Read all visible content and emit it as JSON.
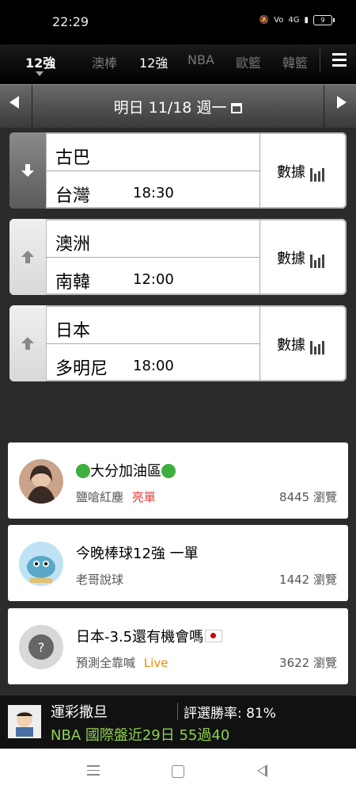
{
  "status": {
    "time": "22:29",
    "network": "4G",
    "battery": "9"
  },
  "tabs": [
    {
      "label": "12強"
    },
    {
      "label": "澳棒"
    },
    {
      "label": "12強"
    },
    {
      "label": "NBA"
    },
    {
      "label": "歐籃"
    },
    {
      "label": "韓籃"
    }
  ],
  "date": {
    "label": "明日 11/18 週一"
  },
  "games": [
    {
      "team1": "古巴",
      "team2": "台灣",
      "time": "18:30",
      "stats_label": "數據"
    },
    {
      "team1": "澳洲",
      "team2": "南韓",
      "time": "12:00",
      "stats_label": "數據"
    },
    {
      "team1": "日本",
      "team2": "多明尼",
      "time": "18:00",
      "stats_label": "數據"
    }
  ],
  "posts": [
    {
      "title": "大分加油區",
      "author": "鹽嗆紅塵",
      "tag": "亮單",
      "tag_color": "#e53935",
      "views": "8445 瀏覽"
    },
    {
      "title": "今晚棒球12強 一單",
      "author": "老哥說球",
      "tag": "",
      "tag_color": "#000000",
      "views": "1442 瀏覽"
    },
    {
      "title": "日本-3.5還有機會嗎",
      "author": "預測全靠喊",
      "tag": "Live",
      "tag_color": "#ef8a00",
      "views": "3622 瀏覽"
    }
  ],
  "footer": {
    "name": "運彩撒旦",
    "rate": "評選勝率: 81%",
    "record": "NBA 國際盤近29日 55過40"
  },
  "colors": {
    "accent_green": "#8fd14f",
    "tag_red": "#e53935",
    "tag_orange": "#ef8a00"
  }
}
